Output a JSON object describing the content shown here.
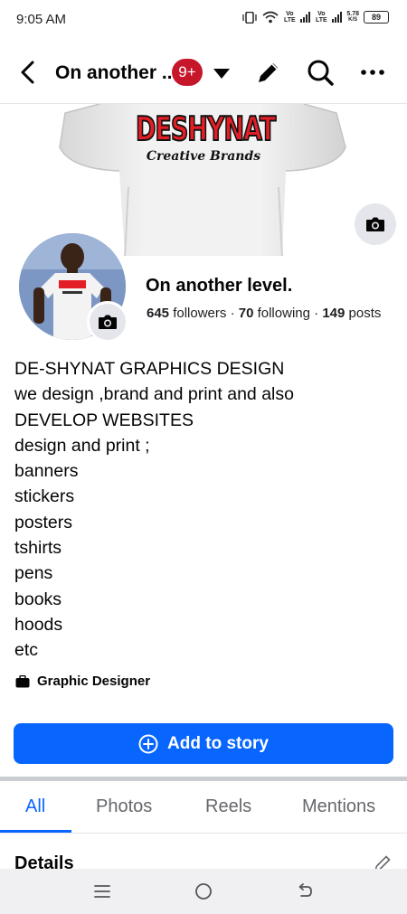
{
  "status_bar": {
    "time": "9:05 AM",
    "net_speed_value": "5.78",
    "net_speed_unit": "K/S",
    "battery": "89",
    "sim_label_1": "Vo LTE",
    "sim_label_2": "Vo LTE"
  },
  "header": {
    "title": "On another ...",
    "notification_badge": "9+"
  },
  "cover": {
    "brand_text": "DESHYNAT",
    "brand_tagline": "Creative Brands"
  },
  "profile": {
    "name": "On another level.",
    "followers_count": "645",
    "followers_label": "followers",
    "following_count": "70",
    "following_label": "following",
    "posts_count": "149",
    "posts_label": "posts",
    "separator": "·"
  },
  "bio": {
    "lines": [
      "DE-SHYNAT GRAPHICS DESIGN",
      "we design ,brand and print and also",
      "DEVELOP WEBSITES",
      "design and print ;",
      "banners",
      "stickers",
      "posters",
      "tshirts",
      "pens",
      "books",
      "hoods",
      "etc"
    ]
  },
  "work": {
    "label": "Graphic Designer"
  },
  "add_story": {
    "label": "Add to story"
  },
  "tabs": [
    {
      "label": "All",
      "active": true
    },
    {
      "label": "Photos",
      "active": false
    },
    {
      "label": "Reels",
      "active": false
    },
    {
      "label": "Mentions",
      "active": false
    }
  ],
  "details": {
    "label": "Details"
  },
  "colors": {
    "accent": "#0866ff",
    "badge": "#c6162a",
    "brand_red": "#e41e26",
    "secondary_text": "#65676b"
  }
}
